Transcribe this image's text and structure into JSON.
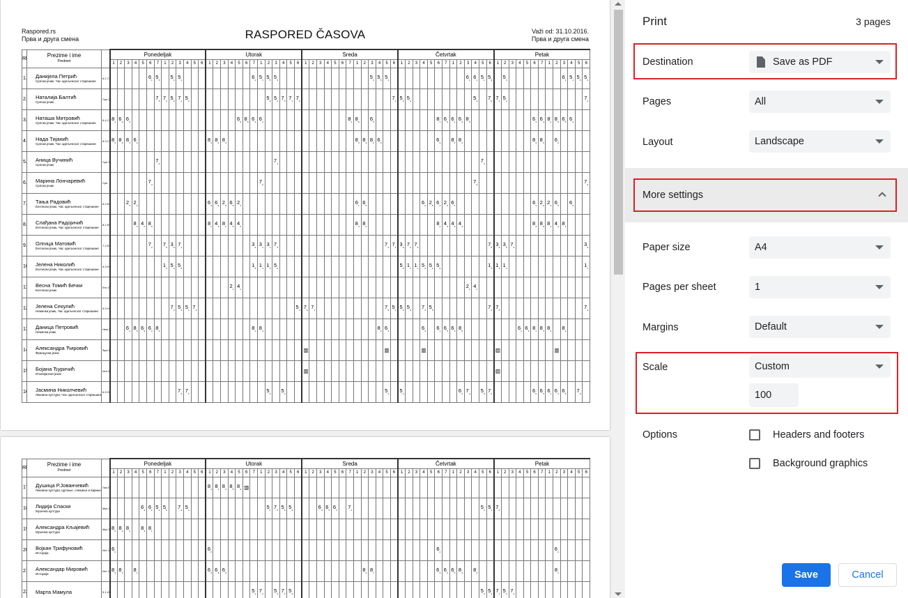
{
  "document": {
    "site": "Raspored.rs",
    "shift_left": "Прва и друга смена",
    "title": "RASPORED ČASOVA",
    "valid_from": "Važi od: 31.10.2016.",
    "shift_right": "Прва и друга смена",
    "rb_label": "Rb",
    "name_header": "Prezime i ime",
    "subject_header": "Predmet",
    "days": [
      "Ponedeljak",
      "Utorak",
      "Sreda",
      "Četvrtak",
      "Petak"
    ],
    "periods": [
      "1",
      "2",
      "3",
      "4",
      "5",
      "6",
      "7",
      "1",
      "2",
      "3",
      "4",
      "5",
      "6"
    ],
    "page1_rows": [
      {
        "no": "1.",
        "name": "Данијела Петрић",
        "subject": "Српски језик, Час одељенског старешине",
        "meta": "6-1 Срп 21",
        "cells": {
          "5": "6₁",
          "6": "5₅",
          "8": "5₄",
          "9": "5₁",
          "19": "6₁",
          "20": "5₁",
          "21": "5₅",
          "22": "5₄",
          "35": "5₄",
          "36": "5₅",
          "37": "5₁",
          "48": "6₁",
          "49": "6₁",
          "50": "5₁",
          "51": "5₅",
          "53": "5₄",
          "61": "6₁",
          "62": "5₁",
          "63": "5₅",
          "64": "5₄"
        }
      },
      {
        "no": "2.",
        "name": "Наталија Балтић",
        "subject": "Српски језик",
        "meta": "Срп 22",
        "cells": {
          "6": "7₅",
          "7": "7₂",
          "8": "5₂",
          "9": "7₁",
          "10": "5₃",
          "21": "5₃",
          "22": "5₂",
          "23": "7₅",
          "24": "7₁",
          "25": "7₂",
          "38": "7₂",
          "39": "5₂",
          "40": "5₃",
          "49": "5₃",
          "51": "7₅",
          "52": "7₁",
          "53": "5₂",
          "64": "7₂",
          "65": "5₂",
          "66": "7₁",
          "67": "5₃",
          "68": "7₅"
        }
      },
      {
        "no": "3.",
        "name": "Наташа Митровић",
        "subject": "Српски језик, Час одељенског старешине",
        "meta": "6-4 Срп 20",
        "cells": {
          "0": "8₁",
          "1": "6₄",
          "2": "6₂",
          "17": "6₅",
          "18": "8₅",
          "19": "6₄",
          "20": "6₂",
          "32": "8₁",
          "33": "8₅",
          "35": "6₅",
          "44": "8₁",
          "45": "6₅",
          "46": "6₂",
          "47": "6₄",
          "48": "8₅",
          "57": "6₂",
          "58": "6₄",
          "59": "8₁",
          "60": "8₅",
          "61": "6₅",
          "62": "6₄"
        }
      },
      {
        "no": "4.",
        "name": "Нада Тијанић",
        "subject": "Српски језик, Час одељенског старешине",
        "meta": "8-3 Срп 21",
        "cells": {
          "0": "8₂",
          "1": "8₄",
          "2": "8₃",
          "3": "6₃",
          "13": "8₃",
          "14": "8₂",
          "15": "8₃",
          "33": "8₃",
          "34": "8₄",
          "35": "8₂",
          "36": "6₃",
          "44": "6₃",
          "46": "8₂",
          "47": "8₄",
          "57": "8₄",
          "58": "8₃",
          "60": "6₃"
        }
      },
      {
        "no": "5.",
        "name": "Аница Вучинић",
        "subject": "Српски језик",
        "meta": "Срп 21",
        "cells": {
          "6": "7₄",
          "22": "7₄",
          "50": "7₄",
          "66": "7₄"
        }
      },
      {
        "no": "6.",
        "name": "Марина Лончаревић",
        "subject": "Српски језик",
        "meta": "Срп",
        "cells": {
          "5": "7₃",
          "20": "7₃",
          "49": "7₃",
          "64": "7₃"
        }
      },
      {
        "no": "7.",
        "name": "Тања Радовић",
        "subject": "Енглески језик, Час одељенског старешине",
        "meta": "6-2 Енг 26",
        "cells": {
          "2": "2₄",
          "3": "2₃",
          "13": "6₃",
          "14": "6₄",
          "15": "2₅",
          "16": "6₅",
          "17": "2₂",
          "33": "6₁",
          "34": "6₅",
          "42": "6₂",
          "43": "2₅",
          "44": "6₄",
          "45": "2₂",
          "46": "6₂",
          "57": "6₁",
          "58": "2₃",
          "59": "2₄",
          "60": "6₅",
          "62": "6₃"
        }
      },
      {
        "no": "8.",
        "name": "Слађана Радојичић",
        "subject": "Енглески језик, Час одељенског старешине",
        "meta": "8-1 Енг 24",
        "cells": {
          "3": "8₄",
          "4": "4₂",
          "5": "8₅",
          "13": "8₁",
          "14": "4₃",
          "15": "8₁",
          "16": "4₅",
          "17": "4₄",
          "33": "8₃",
          "34": "8₂",
          "44": "8₁",
          "45": "4₂",
          "46": "4₅",
          "47": "4₃",
          "57": "8₂",
          "58": "8₅",
          "59": "8₄",
          "60": "4₄",
          "61": "8₃"
        }
      },
      {
        "no": "9.",
        "name": "Олгица Матовић",
        "subject": "Енглески језик, Час одељенског старешине",
        "meta": "7-2 Енг 24",
        "cells": {
          "5": "7₂",
          "7": "7₅",
          "8": "3₅",
          "9": "7₁",
          "19": "3₂",
          "20": "3₄",
          "21": "3₁",
          "22": "7₃",
          "37": "7₂",
          "38": "7₁",
          "39": "3₃",
          "40": "7₄",
          "41": "7₂",
          "51": "7₅",
          "52": "3₄",
          "53": "3₅",
          "54": "7₃",
          "64": "3₃",
          "65": "3₁",
          "66": "3₂",
          "67": "7₄"
        }
      },
      {
        "no": "10.",
        "name": "Јелена Николић",
        "subject": "Енглески језик, Час одељенског старешине",
        "meta": "5-3 Енг 20",
        "cells": {
          "7": "1₂",
          "8": "5₄",
          "9": "5₅",
          "19": "1₅",
          "20": "1₄",
          "21": "1₃",
          "22": "5₂",
          "39": "5₅",
          "40": "1₂",
          "41": "1₁",
          "42": "5₃",
          "43": "5₁",
          "44": "5₄",
          "51": "1₅",
          "52": "1₃",
          "53": "1₄",
          "64": "1₁",
          "65": "5₃",
          "66": "5₁",
          "67": "5₂",
          "68": "5₂"
        }
      },
      {
        "no": "11.",
        "name": "Весна Томић Бечки",
        "subject": "Енглески језик",
        "meta": "Енг 26",
        "cells": {
          "16": "2₁",
          "17": "4₁",
          "48": "2₁",
          "49": "4₁"
        }
      },
      {
        "no": "12.",
        "name": "Јелена Секулић",
        "subject": "Немачки језик, Час одељенског старешине",
        "meta": "5-3 Нем 20",
        "cells": {
          "8": "7₄",
          "9": "5₂",
          "10": "5₁",
          "11": "7₂",
          "25": "5₄",
          "26": "7₅",
          "27": "7₁",
          "37": "7₃",
          "38": "5₁",
          "39": "5₂",
          "40": "5₃",
          "42": "7₄",
          "43": "5₅",
          "51": "7₂",
          "52": "7₅",
          "64": "7₃",
          "65": "7₁",
          "66": "5₅",
          "67": "5₄",
          "68": "5₃",
          "69": "5₃"
        }
      },
      {
        "no": "13.",
        "name": "Даница Петровић",
        "subject": "Немачки језик",
        "meta": "Нем 20",
        "cells": {
          "2": "6₃",
          "3": "8₅",
          "4": "6₅",
          "5": "6₂",
          "6": "8₃",
          "19": "8₁",
          "20": "8₄",
          "36": "8₂",
          "37": "6₄",
          "42": "6₂",
          "44": "6₁",
          "45": "6₅",
          "46": "6₃",
          "47": "8₅",
          "55": "6₁",
          "56": "6₄",
          "57": "8₁",
          "58": "8₂",
          "59": "8₃",
          "61": "8₄"
        }
      },
      {
        "no": "14.",
        "name": "Александра Ћировић",
        "subject": "Француски језик",
        "meta": "Фра 19/3",
        "cells": {
          "26": "▥",
          "37": "▥",
          "42": "▥",
          "52": "▥",
          "60": "▥"
        }
      },
      {
        "no": "15.",
        "name": "Бојана Ђуричић",
        "subject": "Италијански језик",
        "meta": "Ита 20",
        "cells": {
          "26": "▥",
          "52": "▥"
        }
      },
      {
        "no": "16.",
        "name": "Јасмина Николчевић",
        "subject": "Ликовна култура, Час одељенског старешине",
        "meta": "6-5 Лик 01",
        "cells": {
          "9": "7₅",
          "10": "7₁",
          "21": "5₃",
          "23": "5₂",
          "37": "5₁",
          "39": "5₄",
          "47": "6₃",
          "48": "7₄",
          "50": "5₅",
          "51": "7₂",
          "57": "6₅",
          "58": "6₂",
          "59": "6₁",
          "60": "6₄",
          "61": "6₅",
          "63": "7₃"
        }
      }
    ],
    "page2_rows": [
      {
        "no": "17.",
        "name": "Душица Р.Јованчевић",
        "subject": "Ликовна култура, Цртање, сликање и вајање",
        "meta": "Лик 01",
        "cells": {
          "13": "8₄",
          "14": "8₁",
          "15": "8₂",
          "16": "8₅",
          "17": "8₃",
          "18": "▥"
        }
      },
      {
        "no": "18.",
        "name": "Лидија Спаски",
        "subject": "Музичка култура",
        "meta": "Муз 27",
        "cells": {
          "4": "6₄",
          "5": "6₁",
          "6": "5₃",
          "7": "5₅",
          "9": "7₃",
          "10": "5₄",
          "21": "5₁",
          "22": "7₅",
          "23": "5₅",
          "24": "5₃",
          "28": "6₃",
          "29": "6₅",
          "30": "6₂",
          "32": "7₁",
          "50": "5₂",
          "51": "5₁",
          "52": "7₄",
          "66": "5₂",
          "67": "7₂",
          "68": "5₄"
        }
      },
      {
        "no": "19.",
        "name": "Александра Кљајевић",
        "subject": "Музичка култура",
        "meta": "Муз 27",
        "cells": {
          "0": "8₅",
          "1": "8₂",
          "2": "8₄",
          "4": "8₃",
          "5": "8₁"
        }
      },
      {
        "no": "20.",
        "name": "Војкан Трифуновић",
        "subject": "Историја",
        "meta": "Ист 14",
        "cells": {
          "0": "6₁",
          "13": "6₂",
          "44": "6₁",
          "60": "6₂"
        }
      },
      {
        "no": "21.",
        "name": "Александар Мировић",
        "subject": "Историја",
        "meta": "Ист 14",
        "cells": {
          "0": "8₄",
          "1": "8₃",
          "3": "8₂",
          "13": "6₄",
          "14": "6₃",
          "15": "6₅",
          "34": "8₄",
          "35": "8₁",
          "44": "6₄",
          "45": "6₃",
          "46": "6₅",
          "47": "8₃",
          "49": "8₂",
          "60": "8₁"
        }
      },
      {
        "no": "22.",
        "name": "Марта Мамула",
        "subject": "",
        "meta": "5-1 Ист",
        "cells": {
          "19": "5₁",
          "20": "7₂",
          "22": "5₂",
          "23": "7₁",
          "24": "5₄",
          "50": "5₃",
          "51": "5₁",
          "52": "7₁",
          "53": "5₃",
          "54": "7₂"
        }
      }
    ]
  },
  "panel": {
    "title": "Print",
    "page_count": "3 pages",
    "destination": {
      "label": "Destination",
      "value": "Save as PDF"
    },
    "pages": {
      "label": "Pages",
      "value": "All"
    },
    "layout": {
      "label": "Layout",
      "value": "Landscape"
    },
    "more_settings": "More settings",
    "paper_size": {
      "label": "Paper size",
      "value": "A4"
    },
    "pages_per_sheet": {
      "label": "Pages per sheet",
      "value": "1"
    },
    "margins": {
      "label": "Margins",
      "value": "Default"
    },
    "scale": {
      "label": "Scale",
      "value": "Custom",
      "custom_value": "100"
    },
    "options": {
      "label": "Options",
      "headers_footers": "Headers and footers",
      "background_graphics": "Background graphics"
    },
    "save_label": "Save",
    "cancel_label": "Cancel"
  },
  "colors": {
    "highlight": "#dc1f26",
    "accent": "#1a73e8",
    "select_bg": "#f1f3f4"
  }
}
